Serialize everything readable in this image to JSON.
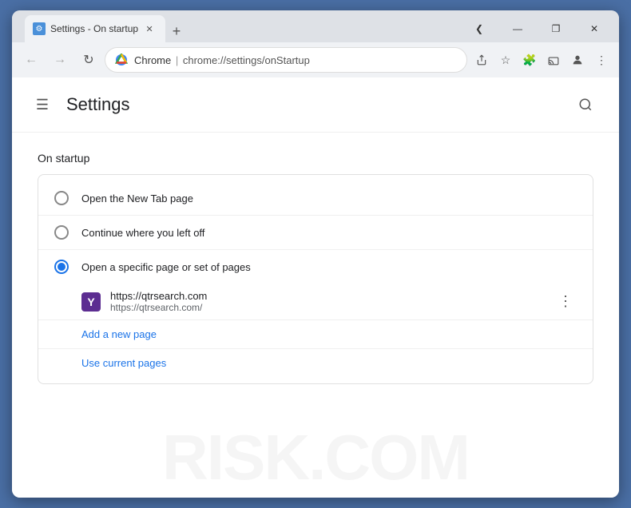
{
  "browser": {
    "title_bar": {
      "tab_title": "Settings - On startup",
      "tab_favicon": "⚙",
      "new_tab_label": "+",
      "chevron_down": "❮",
      "minimize": "—",
      "maximize": "❐",
      "close": "✕"
    },
    "nav_bar": {
      "back_title": "Back",
      "forward_title": "Forward",
      "refresh_title": "Refresh",
      "brand": "Chrome",
      "separator": "|",
      "address": "chrome://settings/onStartup",
      "share_title": "Share",
      "bookmark_title": "Bookmark",
      "extensions_title": "Extensions",
      "cast_title": "Cast",
      "profile_title": "Profile",
      "more_title": "More"
    },
    "page": {
      "settings_title": "Settings",
      "search_placeholder": "Search settings",
      "section": {
        "title": "On startup",
        "option1": "Open the New Tab page",
        "option2": "Continue where you left off",
        "option3": "Open a specific page or set of pages",
        "page_url_main": "https://qtrsearch.com",
        "page_url_sub": "https://qtrsearch.com/",
        "add_page": "Add a new page",
        "use_current": "Use current pages"
      }
    }
  }
}
